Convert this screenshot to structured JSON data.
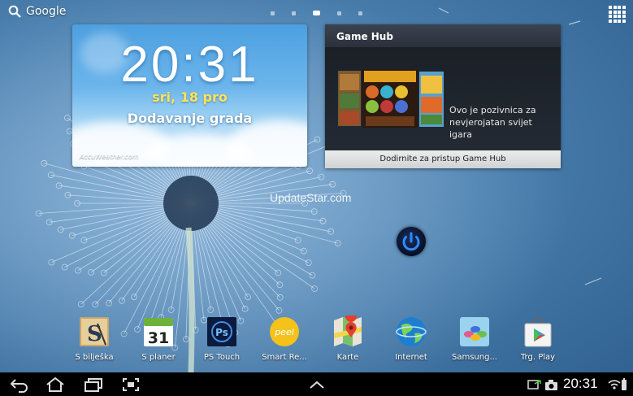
{
  "top_bar": {
    "search_label": "Google",
    "page_count": 5,
    "active_page": 3
  },
  "weather_widget": {
    "time": "20:31",
    "date": "sri, 18 pro",
    "city": "Dodavanje grada",
    "brand": "AccuWeather.com"
  },
  "game_hub": {
    "title": "Game Hub",
    "description": "Ovo je pozivnica za nevjerojatan svijet igara",
    "cta": "Dodirnite za pristup Game Hub"
  },
  "watermark": "UpdateStar.com",
  "dock": {
    "apps": [
      {
        "label": "S bilješka",
        "icon": "s-note-icon"
      },
      {
        "label": "S planer",
        "icon": "s-planner-icon",
        "day": "31"
      },
      {
        "label": "PS Touch",
        "icon": "ps-touch-icon",
        "glyph": "Ps"
      },
      {
        "label": "Smart Re...",
        "icon": "smart-remote-icon",
        "glyph": "peel"
      },
      {
        "label": "Karte",
        "icon": "maps-icon"
      },
      {
        "label": "Internet",
        "icon": "internet-icon"
      },
      {
        "label": "Samsung...",
        "icon": "samsung-apps-icon"
      },
      {
        "label": "Trg. Play",
        "icon": "play-store-icon"
      }
    ]
  },
  "nav_bar": {
    "clock": "20:31"
  },
  "colors": {
    "nav_background": "#000000",
    "planner_green": "#6cb23a",
    "date_yellow": "#ffe45a"
  }
}
